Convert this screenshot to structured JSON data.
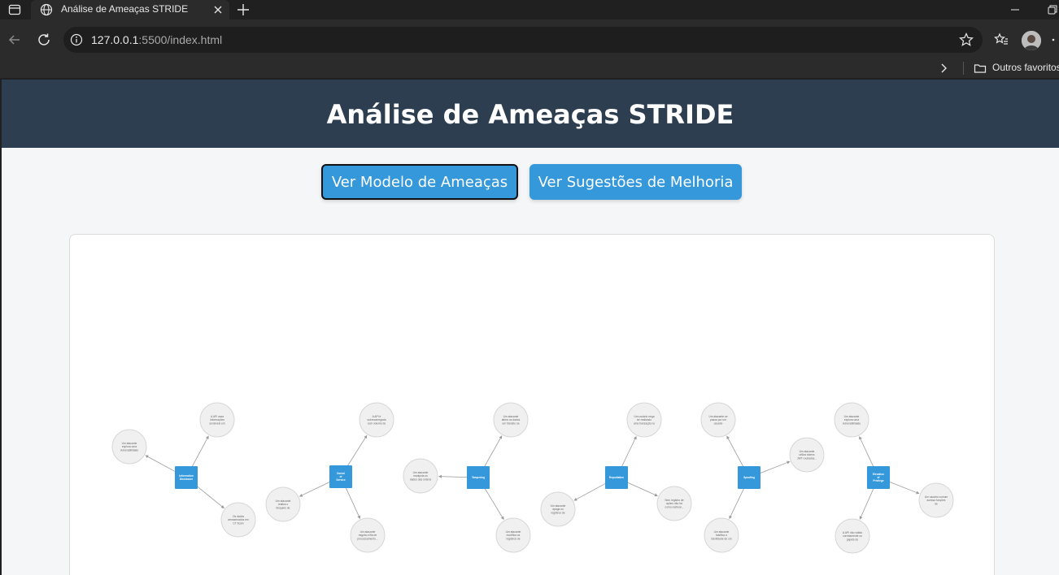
{
  "browser": {
    "tab_title": "Análise de Ameaças STRIDE",
    "url_host": "127.0.0.1",
    "url_rest": ":5500/index.html",
    "bookmarks_folder": "Outros favoritos"
  },
  "page": {
    "title": "Análise de Ameaças STRIDE",
    "buttons": {
      "model": "Ver Modelo de Ameaças",
      "suggestions": "Ver Sugestões de Melhoria"
    }
  },
  "graph": {
    "center_color": "#3498db",
    "leaf_color": "#f0f0f0",
    "clusters": [
      {
        "center": "Information Disclosure",
        "leaves": [
          "Um atacante explora uma vulnerabilidade e a ingestão...",
          "A API vaza informações sensíveis em mensagens de erro...",
          "Os dados armazenados em CT ficam expostos..."
        ]
      },
      {
        "center": "Denial of Service",
        "leaves": [
          "A API é sobrecarregada com volume de requisições...",
          "Um atacante realiza o bloqueio de instâncias de serviço...",
          "Um atacante esgota a fila de processamento..."
        ]
      },
      {
        "center": "Tampering",
        "leaves": [
          "Um atacante altera os dados em trânsito na rede...",
          "Um atacante manipula os dados das ordens antes do envio...",
          "Um atacante modifica os registros de log..."
        ]
      },
      {
        "center": "Repudiation",
        "leaves": [
          "Um usuário nega ter realizado uma transação no sistema...",
          "Um atacante apaga os registros de auditoria...",
          "Sem registro de ações não há como rastrear..."
        ]
      },
      {
        "center": "Spoofing",
        "leaves": [
          "Um atacante se passa por um usuário legítimo...",
          "Um atacante utiliza tokens JWT roubados...",
          "Um atacante falsifica a identidade de um serviço..."
        ]
      },
      {
        "center": "Elevation of Privilege",
        "leaves": [
          "Um atacante explora uma vulnerabilidade e ganha privilégios...",
          "Um usuário comum acessa funções de administrador...",
          "A API não valida corretamente os papéis do usuário..."
        ]
      }
    ]
  }
}
